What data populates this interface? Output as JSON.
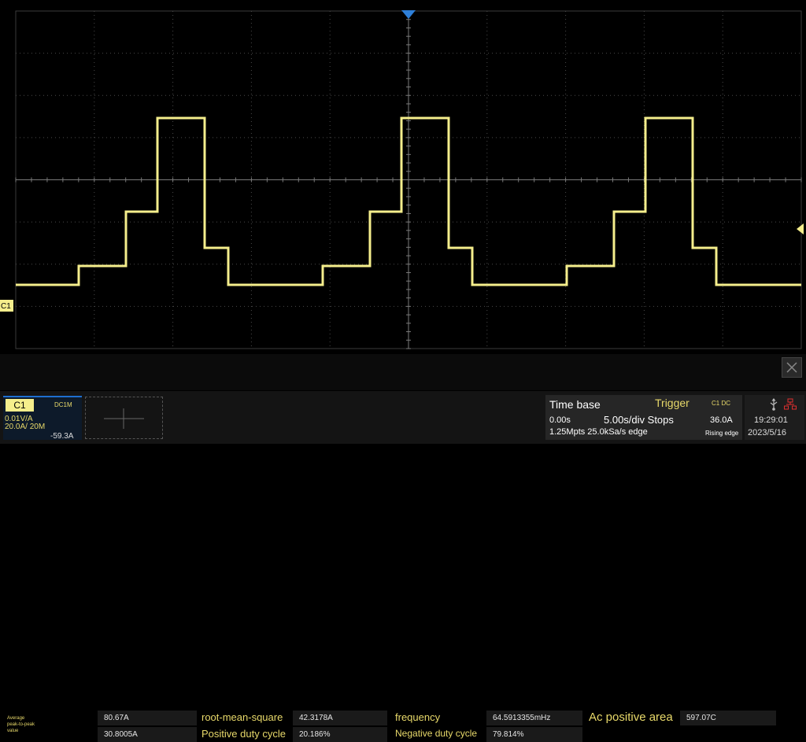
{
  "channel": {
    "name": "C1",
    "coupling": "DC1M",
    "scale": "0.01V/A",
    "range": "20.0A/ 20M",
    "offset": "-59.3A",
    "color": "#f5ee8c"
  },
  "measurements": {
    "avg_peak_label_line1": "Average",
    "avg_peak_label_line2": "peak-to-peak",
    "avg_peak_label_line3": "value",
    "avg_peak_value": "80.67A",
    "rms_label": "root-mean-square",
    "rms_value": "42.3178A",
    "freq_label": "frequency",
    "freq_value": "64.5913355mHz",
    "ac_pos_area_label": "Ac positive area",
    "ac_pos_area_value": "597.07C",
    "row2_value": "30.8005A",
    "pos_duty_label": "Positive duty cycle",
    "pos_duty_value": "20.186%",
    "neg_duty_label": "Negative duty cycle",
    "neg_duty_value": "79.814%"
  },
  "timebase": {
    "title": "Time base",
    "delay": "0.00s",
    "scale_status": "5.00s/div Stops",
    "memory": "1.25Mpts 25.0kSa/s edge"
  },
  "trigger": {
    "title": "Trigger",
    "source": "C1 DC",
    "level": "36.0A",
    "mode": "Rising edge"
  },
  "status": {
    "time": "19:29:01",
    "date": "2023/5/16"
  },
  "icons": {
    "usb": "usb-icon",
    "network": "network-icon",
    "close": "close-icon",
    "trigger_position": "trigger-position-marker-icon",
    "trigger_level": "trigger-level-marker-icon"
  }
}
